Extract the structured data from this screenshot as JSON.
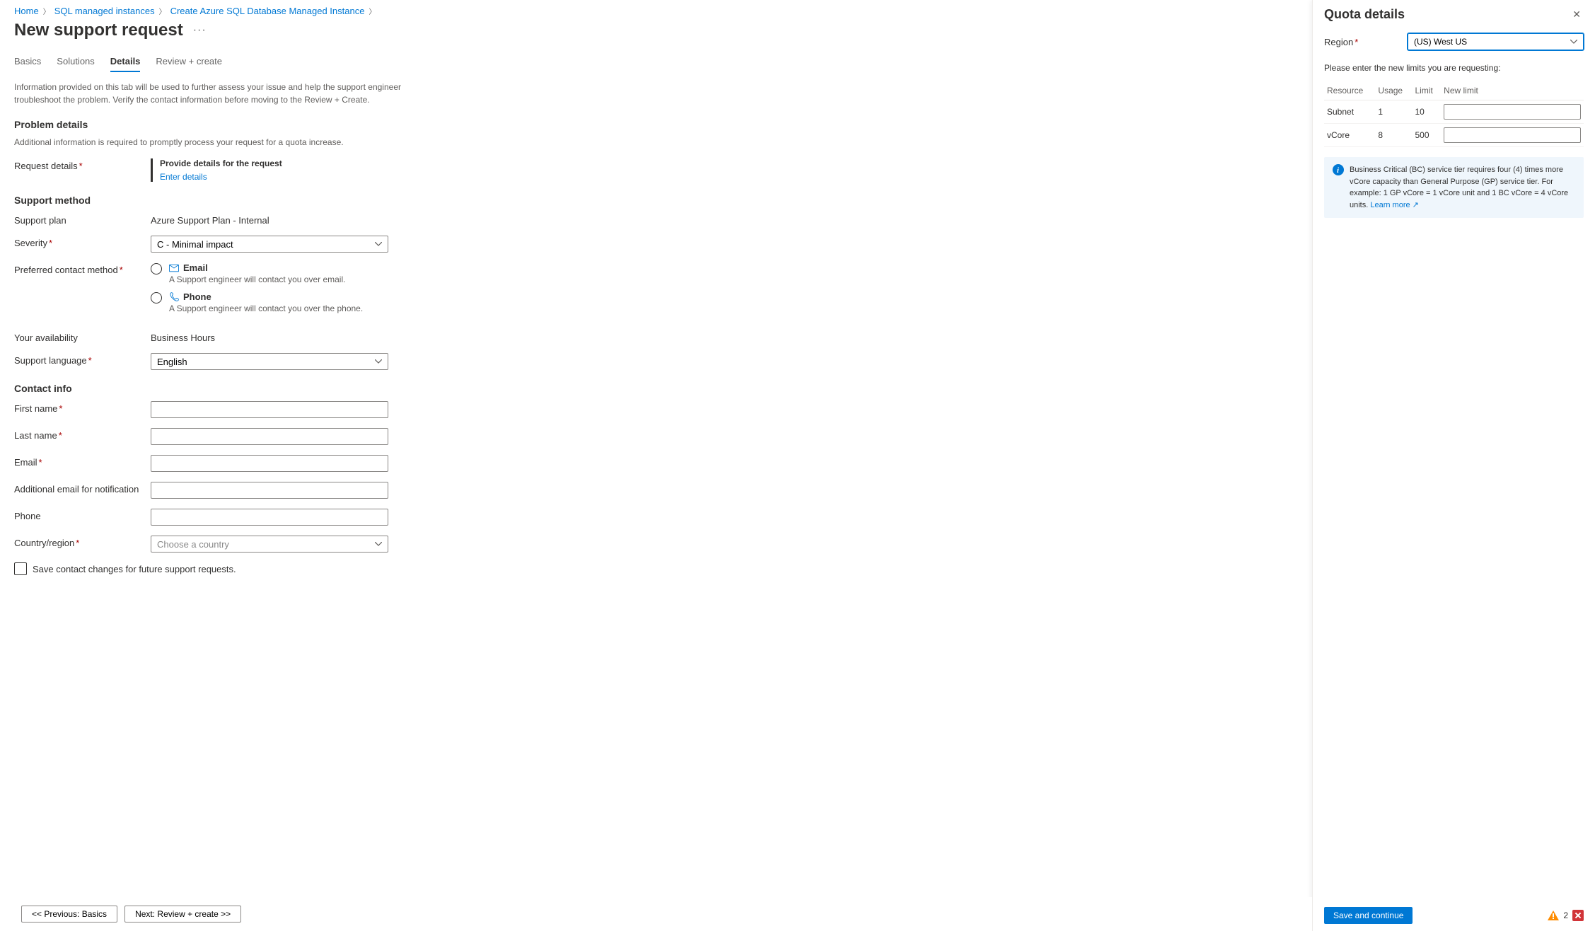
{
  "breadcrumb": [
    "Home",
    "SQL managed instances",
    "Create Azure SQL Database Managed Instance"
  ],
  "page_title": "New support request",
  "tabs": [
    "Basics",
    "Solutions",
    "Details",
    "Review + create"
  ],
  "active_tab": 2,
  "intro": "Information provided on this tab will be used to further assess your issue and help the support engineer troubleshoot the problem. Verify the contact information before moving to the Review + Create.",
  "problem": {
    "heading": "Problem details",
    "sub": "Additional information is required to promptly process your request for a quota increase.",
    "request_label": "Request details",
    "provide_title": "Provide details for the request",
    "enter_link": "Enter details"
  },
  "support": {
    "heading": "Support method",
    "plan_label": "Support plan",
    "plan_value": "Azure Support Plan - Internal",
    "severity_label": "Severity",
    "severity_value": "C - Minimal impact",
    "contact_label": "Preferred contact method",
    "email_label": "Email",
    "email_desc": "A Support engineer will contact you over email.",
    "phone_label": "Phone",
    "phone_desc": "A Support engineer will contact you over the phone.",
    "avail_label": "Your availability",
    "avail_value": "Business Hours",
    "lang_label": "Support language",
    "lang_value": "English"
  },
  "contact": {
    "heading": "Contact info",
    "first": "First name",
    "last": "Last name",
    "email": "Email",
    "addl": "Additional email for notification",
    "phone": "Phone",
    "country": "Country/region",
    "country_placeholder": "Choose a country",
    "save": "Save contact changes for future support requests."
  },
  "footer": {
    "prev": "<< Previous: Basics",
    "next": "Next: Review + create >>"
  },
  "panel": {
    "title": "Quota details",
    "region_label": "Region",
    "region_value": "(US) West US",
    "limits_text": "Please enter the new limits you are requesting:",
    "th": {
      "resource": "Resource",
      "usage": "Usage",
      "limit": "Limit",
      "newlimit": "New limit"
    },
    "rows": [
      {
        "resource": "Subnet",
        "usage": "1",
        "limit": "10"
      },
      {
        "resource": "vCore",
        "usage": "8",
        "limit": "500"
      }
    ],
    "info": "Business Critical (BC) service tier requires four (4) times more vCore capacity than General Purpose (GP) service tier. For example: 1 GP vCore = 1 vCore unit and 1 BC vCore = 4 vCore units. ",
    "learn": "Learn more",
    "save_btn": "Save and continue",
    "warn_count": "2"
  }
}
